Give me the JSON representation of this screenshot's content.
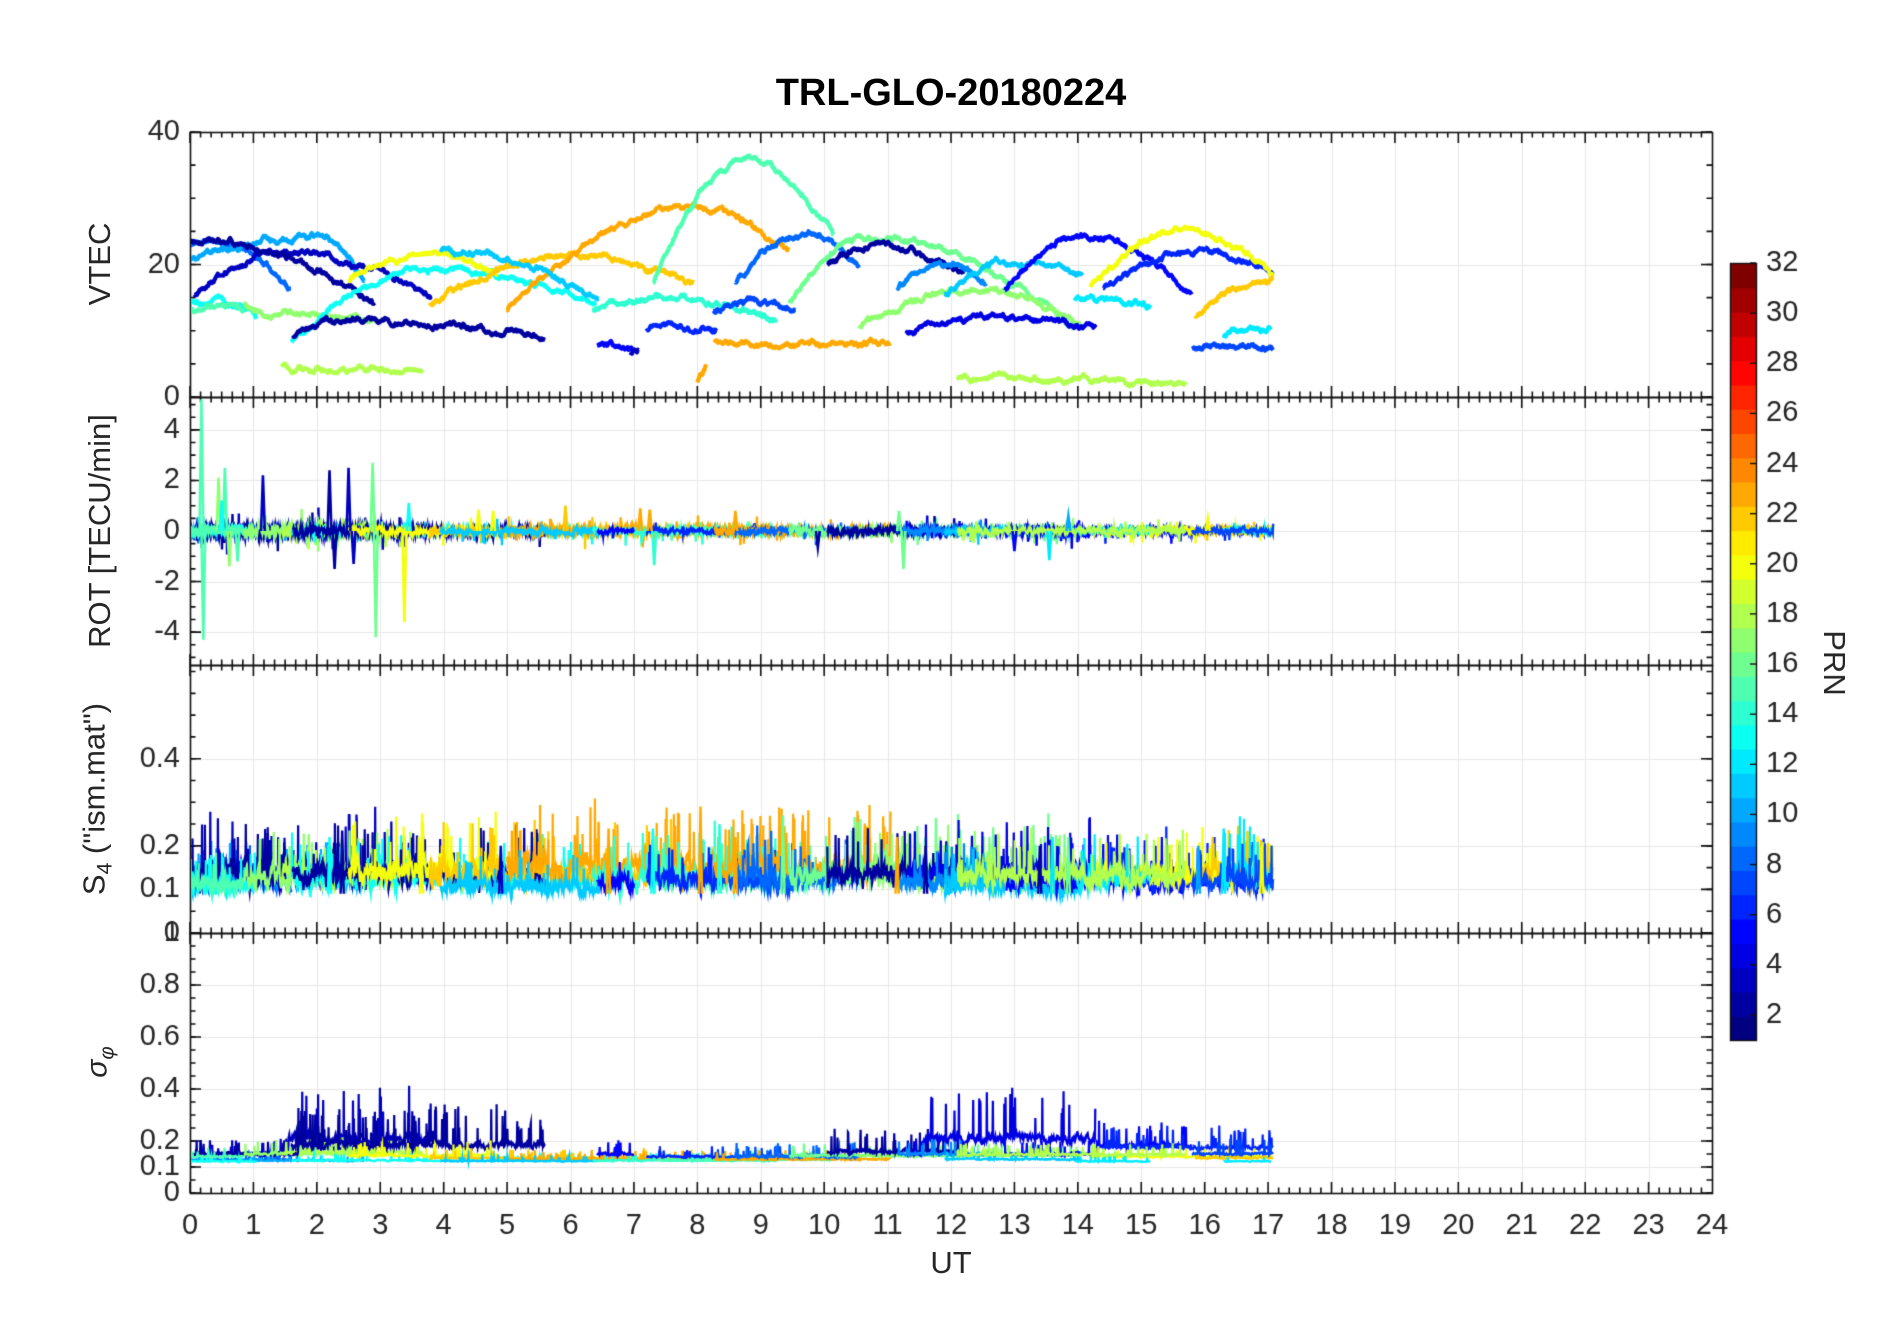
{
  "chart_data": {
    "type": "line",
    "title": "TRL-GLO-20180224",
    "xlabel": "UT",
    "x_range": [
      0,
      24
    ],
    "x_ticks": [
      "0",
      "1",
      "2",
      "3",
      "4",
      "5",
      "6",
      "7",
      "8",
      "9",
      "10",
      "11",
      "12",
      "13",
      "14",
      "15",
      "16",
      "17",
      "18",
      "19",
      "20",
      "21",
      "22",
      "23",
      "24"
    ],
    "x_minor_step_hours": 0.1666667,
    "data_end_ut": 17.08,
    "grid": "on",
    "colormap": "jet",
    "colorbar": {
      "label": "PRN",
      "min": 1,
      "max": 32,
      "ticks": [
        2,
        4,
        6,
        8,
        10,
        12,
        14,
        16,
        18,
        20,
        22,
        24,
        26,
        28,
        30,
        32
      ],
      "discrete_levels": 32
    },
    "panels": [
      {
        "id": "vtec",
        "ylabel": "VTEC",
        "range": [
          0,
          40
        ],
        "ticks": [
          [
            0,
            "0"
          ],
          [
            20,
            "20"
          ],
          [
            40,
            "40"
          ]
        ],
        "minor": 5
      },
      {
        "id": "rot",
        "ylabel": "ROT [TECU/min]",
        "range": [
          -5.3,
          5.3
        ],
        "ticks": [
          [
            -4,
            "-4"
          ],
          [
            -2,
            "-2"
          ],
          [
            0,
            "0"
          ],
          [
            2,
            "2"
          ],
          [
            4,
            "4"
          ]
        ],
        "minor": 0.5
      },
      {
        "id": "s4",
        "ylabel": "S4 (\"ism.mat\")",
        "ylabel_parts": {
          "main": "S",
          "sub": "4",
          "rest": " (\"ism.mat\")"
        },
        "range": [
          0,
          0.615
        ],
        "ticks": [
          [
            0,
            "0"
          ],
          [
            0.1,
            "0.1"
          ],
          [
            0.2,
            "0.2"
          ],
          [
            0.4,
            "0.4"
          ]
        ],
        "minor": 0.05
      },
      {
        "id": "sigma_phi",
        "ylabel": "σφ",
        "ylabel_parts": {
          "main": "σ",
          "sub": "φ"
        },
        "range": [
          0,
          1.0
        ],
        "ticks": [
          [
            0,
            "0"
          ],
          [
            0.1,
            "0.1"
          ],
          [
            0.2,
            "0.2"
          ],
          [
            0.4,
            "0.4"
          ],
          [
            0.6,
            "0.6"
          ],
          [
            0.8,
            "0.8"
          ],
          [
            1,
            "1"
          ]
        ],
        "minor": 0.05
      }
    ],
    "arcs": [
      {
        "p": 8,
        "t0": 0,
        "tp": 0.35,
        "t1": 1.6,
        "v0": 22.8,
        "vp": 23.6,
        "v1": 16.2,
        "ra": 0.25,
        "s4b": 0.09,
        "s4a": 0.035,
        "sgb": 0.128,
        "sga": 0.012
      },
      {
        "p": 10,
        "t0": 0,
        "tp": 2.05,
        "t1": 2.75,
        "v0": 20.8,
        "vp": 24.2,
        "v1": 17.5,
        "ra": 0.3,
        "s4b": 0.09,
        "s4a": 0.035,
        "sgb": 0.125,
        "sga": 0.01
      },
      {
        "p": 3,
        "t0": 0.07,
        "tp": 1.45,
        "t1": 3.8,
        "v0": 15.6,
        "vp": 21.9,
        "v1": 15.4,
        "ra": 0.5,
        "s4b": 0.1,
        "s4a": 0.05,
        "sgb": 0.205,
        "sga": 0.07,
        "sgt0": 1.55
      },
      {
        "p": 2,
        "t0": 0,
        "tp": 0.4,
        "t1": 2.92,
        "v0": 23.2,
        "vp": 23.4,
        "v1": 13.9,
        "ra": 0.45,
        "s4b": 0.1,
        "s4a": 0.045,
        "sgb": 0.175,
        "sga": 0.048,
        "sgt0": 1.6
      },
      {
        "p": 13,
        "t0": 0,
        "tp": 0.4,
        "t1": 1.05,
        "v0": 14.3,
        "vp": 14.6,
        "v1": 11.8,
        "ra": 0.3,
        "s4b": 0.08,
        "s4a": 0.03,
        "sgb": 0.122,
        "sga": 0.008
      },
      {
        "p": 15,
        "t0": 0,
        "tp": 0.4,
        "t1": 0.85,
        "v0": 13.1,
        "vp": 13.8,
        "v1": 13.2,
        "ra": 0.3,
        "s4b": 0.09,
        "s4a": 0.03,
        "sgb": 0.14,
        "sga": 0.015
      },
      {
        "p": 17,
        "t0": 0.85,
        "tp": 1.3,
        "t1": 3.0,
        "v0": 13.9,
        "vp": 12.5,
        "v1": 11.3,
        "ra": 0.5,
        "s4b": 0.1,
        "s4a": 0.04,
        "sgb": 0.152,
        "sga": 0.02
      },
      {
        "p": 18,
        "t0": 1.45,
        "tp": 2.5,
        "t1": 3.67,
        "v0": 4.6,
        "vp": 4.3,
        "v1": 3.9,
        "ra": 0.35,
        "s4b": 0.1,
        "s4a": 0.04,
        "sgb": 0.155,
        "sga": 0.02
      },
      {
        "p": 13,
        "t0": 1.6,
        "tp": 3.7,
        "t1": 6.4,
        "v0": 8.2,
        "vp": 19.4,
        "v1": 14.2,
        "ra": 0.3,
        "s4b": 0.09,
        "s4a": 0.04,
        "sgb": 0.125,
        "sga": 0.01
      },
      {
        "p": 2,
        "t0": 1.62,
        "tp": 2.4,
        "t1": 5.6,
        "v0": 9.4,
        "vp": 11.7,
        "v1": 8.9,
        "ra": 0.4,
        "s4b": 0.1,
        "s4a": 0.045,
        "sgb": 0.185,
        "sga": 0.05,
        "sgt0": 1.7
      },
      {
        "p": 20,
        "t0": 2.5,
        "tp": 3.75,
        "t1": 4.85,
        "v0": 17.8,
        "vp": 21.6,
        "v1": 18.8,
        "ra": 0.3,
        "s4b": 0.11,
        "s4a": 0.045,
        "sgb": 0.145,
        "sga": 0.018
      },
      {
        "p": 22,
        "t0": 3.78,
        "tp": 6.0,
        "t1": 7.95,
        "v0": 13.9,
        "vp": 21.5,
        "v1": 16.8,
        "ra": 0.3,
        "s4b": 0.1,
        "s4a": 0.05,
        "sgb": 0.135,
        "sga": 0.012
      },
      {
        "p": 23,
        "t0": 5.0,
        "tp": 7.9,
        "t1": 9.45,
        "v0": 13.0,
        "vp": 28.9,
        "v1": 21.8,
        "ra": 0.35,
        "s4b": 0.11,
        "s4a": 0.055,
        "sgb": 0.13,
        "sga": 0.012
      },
      {
        "p": 11,
        "t0": 3.95,
        "tp": 4.3,
        "t1": 6.45,
        "v0": 22.3,
        "vp": 21.8,
        "v1": 14.3,
        "ra": 0.25,
        "s4b": 0.08,
        "s4a": 0.03,
        "sgb": 0.123,
        "sga": 0.008
      },
      {
        "p": 14,
        "t0": 6.35,
        "tp": 7.55,
        "t1": 9.25,
        "v0": 13.0,
        "vp": 15.0,
        "v1": 11.5,
        "ra": 0.25,
        "s4b": 0.09,
        "s4a": 0.045,
        "sgb": 0.125,
        "sga": 0.01
      },
      {
        "p": 15,
        "t0": 7.3,
        "tp": 8.75,
        "t1": 10.15,
        "v0": 17.0,
        "vp": 35.8,
        "v1": 24.6,
        "ra": 0.25,
        "s4b": 0.09,
        "s4a": 0.04,
        "sgb": 0.128,
        "sga": 0.01
      },
      {
        "p": 7,
        "t0": 8.25,
        "tp": 8.95,
        "t1": 9.55,
        "v0": 13.2,
        "vp": 14.3,
        "v1": 13.3,
        "ra": 0.2,
        "s4b": 0.09,
        "s4a": 0.035,
        "sgb": 0.14,
        "sga": 0.015
      },
      {
        "p": 6,
        "t0": 7.2,
        "tp": 7.8,
        "t1": 8.3,
        "v0": 10.2,
        "vp": 10.5,
        "v1": 10.1,
        "ra": 0.2,
        "s4b": 0.09,
        "s4a": 0.035,
        "sgb": 0.14,
        "sga": 0.015
      },
      {
        "p": 5,
        "t0": 6.42,
        "tp": 6.7,
        "t1": 7.0,
        "v0": 7.7,
        "vp": 7.9,
        "v1": 7.3,
        "ra": 0.2,
        "s4b": 0.09,
        "s4a": 0.03,
        "sgb": 0.15,
        "sga": 0.02
      },
      {
        "p": 23,
        "t0": 8.27,
        "tp": 9.0,
        "t1": 11.05,
        "v0": 8.7,
        "vp": 7.8,
        "v1": 8.4,
        "ra": 0.3,
        "s4b": 0.11,
        "s4a": 0.055,
        "sgb": 0.13,
        "sga": 0.012
      },
      {
        "p": 8,
        "t0": 8.6,
        "tp": 9.75,
        "t1": 10.55,
        "v0": 17.2,
        "vp": 24.5,
        "v1": 19.6,
        "ra": 0.25,
        "s4b": 0.09,
        "s4a": 0.04,
        "sgb": 0.14,
        "sga": 0.02
      },
      {
        "p": 16,
        "t0": 9.45,
        "tp": 10.72,
        "t1": 13.95,
        "v0": 14.2,
        "vp": 24.3,
        "v1": 10.4,
        "ra": 0.3,
        "s4b": 0.1,
        "s4a": 0.045,
        "sgb": 0.145,
        "sga": 0.018
      },
      {
        "p": 17,
        "t0": 10.55,
        "tp": 12.45,
        "t1": 14.07,
        "v0": 11.0,
        "vp": 16.3,
        "v1": 10.5,
        "ra": 0.25,
        "s4b": 0.1,
        "s4a": 0.04,
        "sgb": 0.145,
        "sga": 0.015
      },
      {
        "p": 2,
        "t0": 10.05,
        "tp": 10.7,
        "t1": 12.2,
        "v0": 19.8,
        "vp": 23.0,
        "v1": 18.3,
        "ra": 0.3,
        "s4b": 0.1,
        "s4a": 0.045,
        "sgb": 0.16,
        "sga": 0.03
      },
      {
        "p": 4,
        "t0": 11.3,
        "tp": 12.6,
        "t1": 14.28,
        "v0": 9.6,
        "vp": 12.2,
        "v1": 10.1,
        "ra": 0.3,
        "s4b": 0.1,
        "s4a": 0.05,
        "sgb": 0.21,
        "sga": 0.065,
        "sgt0": 11.55
      },
      {
        "p": 9,
        "t0": 11.15,
        "tp": 11.95,
        "t1": 12.55,
        "v0": 16.6,
        "vp": 19.9,
        "v1": 17.4,
        "ra": 0.25,
        "s4b": 0.09,
        "s4a": 0.035,
        "sgb": 0.15,
        "sga": 0.02
      },
      {
        "p": 11,
        "t0": 11.9,
        "tp": 12.9,
        "t1": 14.07,
        "v0": 15.6,
        "vp": 20.5,
        "v1": 18.3,
        "ra": 0.25,
        "s4b": 0.08,
        "s4a": 0.03,
        "sgb": 0.13,
        "sga": 0.012
      },
      {
        "p": 5,
        "t0": 12.85,
        "tp": 14.05,
        "t1": 15.8,
        "v0": 16.2,
        "vp": 24.2,
        "v1": 15.6,
        "ra": 0.25,
        "s4b": 0.09,
        "s4a": 0.04,
        "sgb": 0.185,
        "sga": 0.035,
        "sgt0": 14.3
      },
      {
        "p": 6,
        "t0": 14.4,
        "tp": 15.92,
        "t1": 17.08,
        "v0": 16.3,
        "vp": 21.9,
        "v1": 18.6,
        "ra": 0.25,
        "s4b": 0.09,
        "s4a": 0.04,
        "sgb": 0.175,
        "sga": 0.028
      },
      {
        "p": 20,
        "t0": 14.2,
        "tp": 15.7,
        "t1": 17.08,
        "v0": 16.5,
        "vp": 25.4,
        "v1": 18.3,
        "ra": 0.25,
        "s4b": 0.1,
        "s4a": 0.04,
        "sgb": 0.14,
        "sga": 0.012
      },
      {
        "p": 22,
        "t0": 15.85,
        "tp": 16.9,
        "t1": 17.08,
        "v0": 12.3,
        "vp": 17.2,
        "v1": 17.8,
        "ra": 0.25,
        "s4b": 0.1,
        "s4a": 0.045,
        "sgb": 0.135,
        "sga": 0.01
      },
      {
        "p": 12,
        "t0": 13.95,
        "tp": 14.5,
        "t1": 15.15,
        "v0": 14.7,
        "vp": 14.6,
        "v1": 13.8,
        "ra": 0.2,
        "s4b": 0.09,
        "s4a": 0.04,
        "sgb": 0.122,
        "sga": 0.008
      },
      {
        "p": 12,
        "t0": 16.3,
        "tp": 16.8,
        "t1": 17.05,
        "v0": 9.3,
        "vp": 10.2,
        "v1": 10.5,
        "ra": 0.2,
        "s4b": 0.1,
        "s4a": 0.05,
        "sgb": 0.122,
        "sga": 0.008
      },
      {
        "p": 7,
        "t0": 15.8,
        "tp": 16.4,
        "t1": 17.08,
        "v0": 7.4,
        "vp": 7.2,
        "v1": 7.4,
        "ra": 0.2,
        "s4b": 0.09,
        "s4a": 0.035,
        "sgb": 0.15,
        "sga": 0.02
      },
      {
        "p": 18,
        "t0": 12.1,
        "tp": 13.9,
        "t1": 15.7,
        "v0": 2.9,
        "vp": 2.6,
        "v1": 2.0,
        "ra": 0.25,
        "s4b": 0.1,
        "s4a": 0.04,
        "sgb": 0.148,
        "sga": 0.015
      },
      {
        "p": 23,
        "t0": 8.0,
        "tp": 8.07,
        "t1": 8.14,
        "v0": 2.1,
        "vp": 3.4,
        "v1": 4.6,
        "ra": 0,
        "minor": true
      },
      {
        "p": 3,
        "t0": 6.95,
        "tp": 7.0,
        "t1": 7.08,
        "v0": 6.2,
        "vp": 6.8,
        "v1": 7.2,
        "ra": 0,
        "minor": true
      }
    ],
    "rot_spikes": [
      {
        "p": 15,
        "t": 0.18,
        "v": 5.2
      },
      {
        "p": 15,
        "t": 0.21,
        "v": -4.3
      },
      {
        "p": 15,
        "t": 0.55,
        "v": 2.5
      },
      {
        "p": 15,
        "t": 0.75,
        "v": -1.2
      },
      {
        "p": 17,
        "t": 0.45,
        "v": 2.1
      },
      {
        "p": 13,
        "t": 0.5,
        "v": 1.2
      },
      {
        "p": 17,
        "t": 0.62,
        "v": -1.4
      },
      {
        "p": 3,
        "t": 1.15,
        "v": 2.2
      },
      {
        "p": 2,
        "t": 2.2,
        "v": 2.4
      },
      {
        "p": 2,
        "t": 2.28,
        "v": -1.5
      },
      {
        "p": 3,
        "t": 2.5,
        "v": 2.5
      },
      {
        "p": 3,
        "t": 2.58,
        "v": -1.3
      },
      {
        "p": 16,
        "t": 2.88,
        "v": 2.7
      },
      {
        "p": 16,
        "t": 2.93,
        "v": -4.2
      },
      {
        "p": 20,
        "t": 3.38,
        "v": -3.6
      },
      {
        "p": 13,
        "t": 3.45,
        "v": 1.1
      },
      {
        "p": 20,
        "t": 4.55,
        "v": 0.85
      },
      {
        "p": 20,
        "t": 4.78,
        "v": 0.8
      },
      {
        "p": 22,
        "t": 5.92,
        "v": 1.0
      },
      {
        "p": 23,
        "t": 7.1,
        "v": 0.9
      },
      {
        "p": 14,
        "t": 7.32,
        "v": -1.35
      },
      {
        "p": 23,
        "t": 7.25,
        "v": 0.85
      },
      {
        "p": 23,
        "t": 8.6,
        "v": 0.8
      },
      {
        "p": 2,
        "t": 9.9,
        "v": -0.65
      },
      {
        "p": 16,
        "t": 11.18,
        "v": 0.8
      },
      {
        "p": 16,
        "t": 11.25,
        "v": -1.5
      },
      {
        "p": 5,
        "t": 13.0,
        "v": -0.8
      },
      {
        "p": 12,
        "t": 13.55,
        "v": -1.15
      },
      {
        "p": 10,
        "t": 13.85,
        "v": 0.6
      },
      {
        "p": 20,
        "t": 16.05,
        "v": 0.5
      }
    ],
    "s4_spikes": [
      {
        "p": 2,
        "t": 2.4,
        "v": 0.235
      },
      {
        "p": 13,
        "t": 2.2,
        "v": 0.22
      },
      {
        "p": 20,
        "t": 3.65,
        "v": 0.21
      },
      {
        "p": 3,
        "t": 4.9,
        "v": 0.2
      },
      {
        "p": 23,
        "t": 6.6,
        "v": 0.24
      },
      {
        "p": 13,
        "t": 7.3,
        "v": 0.24
      },
      {
        "p": 23,
        "t": 8.05,
        "v": 0.29
      },
      {
        "p": 14,
        "t": 8.35,
        "v": 0.25
      },
      {
        "p": 23,
        "t": 8.6,
        "v": 0.22
      },
      {
        "p": 16,
        "t": 9.35,
        "v": 0.27
      },
      {
        "p": 23,
        "t": 11.15,
        "v": 0.22
      },
      {
        "p": 2,
        "t": 11.6,
        "v": 0.2
      },
      {
        "p": 2,
        "t": 13.4,
        "v": 0.2
      },
      {
        "p": 12,
        "t": 13.6,
        "v": 0.22
      },
      {
        "p": 16,
        "t": 13.85,
        "v": 0.22
      },
      {
        "p": 10,
        "t": 15.9,
        "v": 0.2
      },
      {
        "p": 12,
        "t": 16.3,
        "v": 0.24
      },
      {
        "p": 20,
        "t": 16.9,
        "v": 0.2
      }
    ]
  }
}
